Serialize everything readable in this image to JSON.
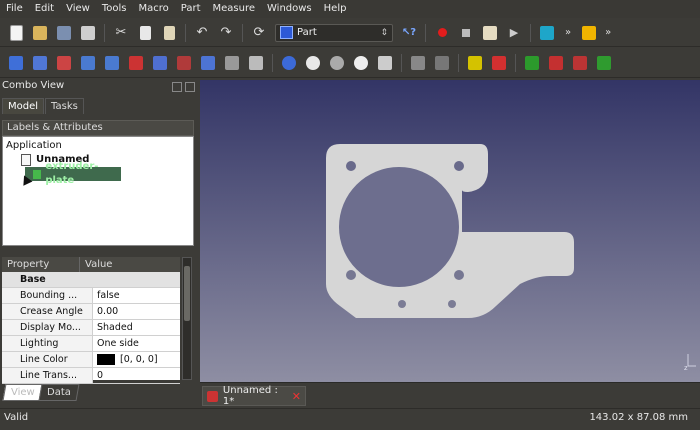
{
  "menubar": [
    {
      "label": "File"
    },
    {
      "label": "Edit"
    },
    {
      "label": "View"
    },
    {
      "label": "Tools"
    },
    {
      "label": "Macro"
    },
    {
      "label": "Part"
    },
    {
      "label": "Measure"
    },
    {
      "label": "Windows"
    },
    {
      "label": "Help"
    }
  ],
  "workbench": {
    "label": "Part",
    "icon": "part-cube-icon"
  },
  "combo_view": {
    "title": "Combo View",
    "tabs": [
      {
        "label": "Model"
      },
      {
        "label": "Tasks"
      }
    ],
    "labels_header": "Labels & Attributes",
    "tree": {
      "root": "Application",
      "document": "Unnamed",
      "item": "extruder-plate"
    },
    "properties": {
      "col_property": "Property",
      "col_value": "Value",
      "group": "Base",
      "rows": [
        {
          "name": "Bounding ...",
          "value": "false"
        },
        {
          "name": "Crease Angle",
          "value": "0.00"
        },
        {
          "name": "Display Mo...",
          "value": "Shaded"
        },
        {
          "name": "Lighting",
          "value": "One side"
        },
        {
          "name": "Line Color",
          "value": "[0, 0, 0]",
          "swatch": "#000000"
        },
        {
          "name": "Line Trans...",
          "value": "0"
        }
      ]
    },
    "bottom_tabs": [
      {
        "label": "View"
      },
      {
        "label": "Data"
      }
    ]
  },
  "document_tab": {
    "label": "Unnamed : 1*"
  },
  "status": {
    "left": "Valid",
    "right": "143.02 x 87.08 mm"
  },
  "colors": {
    "viewport_top": "#333566",
    "viewport_bottom": "#8e8ea3",
    "part_fill": "#d6d6d6"
  }
}
